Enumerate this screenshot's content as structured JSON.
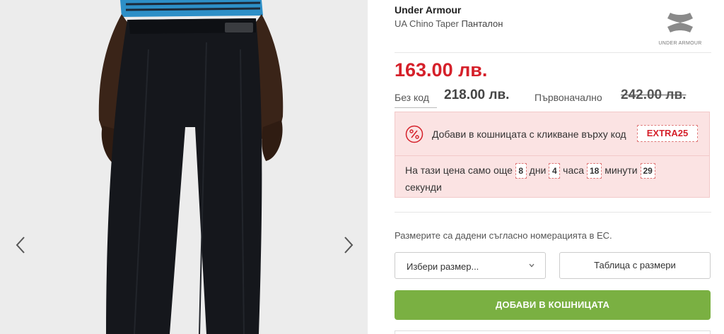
{
  "product": {
    "brand": "Under Armour",
    "model": "UA Chino Taper",
    "category": "Панталон",
    "logo_text": "UNDER ARMOUR"
  },
  "pricing": {
    "current_price": "163.00 лв.",
    "no_code_label": "Без код",
    "no_code_price": "218.00 лв.",
    "original_label": "Първоначално",
    "original_price": "242.00 лв."
  },
  "promo": {
    "text": "Добави в кошницата с кликване върху код",
    "code": "EXTRA25",
    "countdown_prefix": "На тази цена само още",
    "days": "8",
    "days_label": "дни",
    "hours": "4",
    "hours_label": "часа",
    "minutes": "18",
    "minutes_label": "минути",
    "seconds": "29",
    "seconds_label": "секунди"
  },
  "sizes": {
    "note": "Размерите са дадени съгласно номерацията в ЕС.",
    "select_placeholder": "Избери размер...",
    "table_label": "Таблица с размери"
  },
  "actions": {
    "add_to_cart": "ДОБАВИ В КОШНИЦАТА"
  },
  "colors": {
    "price_red": "#d5202a",
    "promo_bg": "#fbe3e3",
    "cart_green": "#7ab042"
  },
  "icons": {
    "prev": "chevron-left-icon",
    "next": "chevron-right-icon",
    "percent": "percent-icon",
    "dropdown": "chevron-down-icon"
  }
}
